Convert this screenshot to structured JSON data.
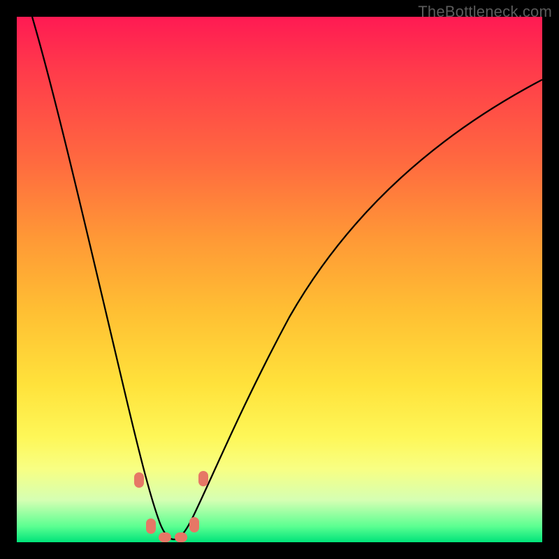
{
  "watermark": "TheBottleneck.com",
  "colors": {
    "background_frame": "#000000",
    "gradient_top": "#ff1a53",
    "gradient_bottom": "#00e37a",
    "curve_stroke": "#000000",
    "marker_fill": "#e67766"
  },
  "chart_data": {
    "type": "line",
    "title": "",
    "xlabel": "",
    "ylabel": "",
    "xlim": [
      0,
      100
    ],
    "ylim": [
      0,
      100
    ],
    "grid": false,
    "legend": false,
    "series": [
      {
        "name": "bottleneck-curve",
        "x": [
          3,
          6,
          10,
          14,
          18,
          21,
          23,
          25,
          27,
          29,
          31,
          34,
          38,
          44,
          52,
          62,
          74,
          88,
          100
        ],
        "y": [
          100,
          87,
          70,
          53,
          35,
          21,
          12,
          5,
          1,
          0,
          1,
          5,
          13,
          25,
          40,
          55,
          68,
          80,
          88
        ]
      }
    ],
    "markers": [
      {
        "x": 23.0,
        "y": 11.5
      },
      {
        "x": 25.0,
        "y": 3.0
      },
      {
        "x": 27.5,
        "y": 0.5
      },
      {
        "x": 30.5,
        "y": 0.8
      },
      {
        "x": 33.0,
        "y": 3.2
      },
      {
        "x": 35.0,
        "y": 11.0
      }
    ],
    "minimum_x": 28.5
  }
}
